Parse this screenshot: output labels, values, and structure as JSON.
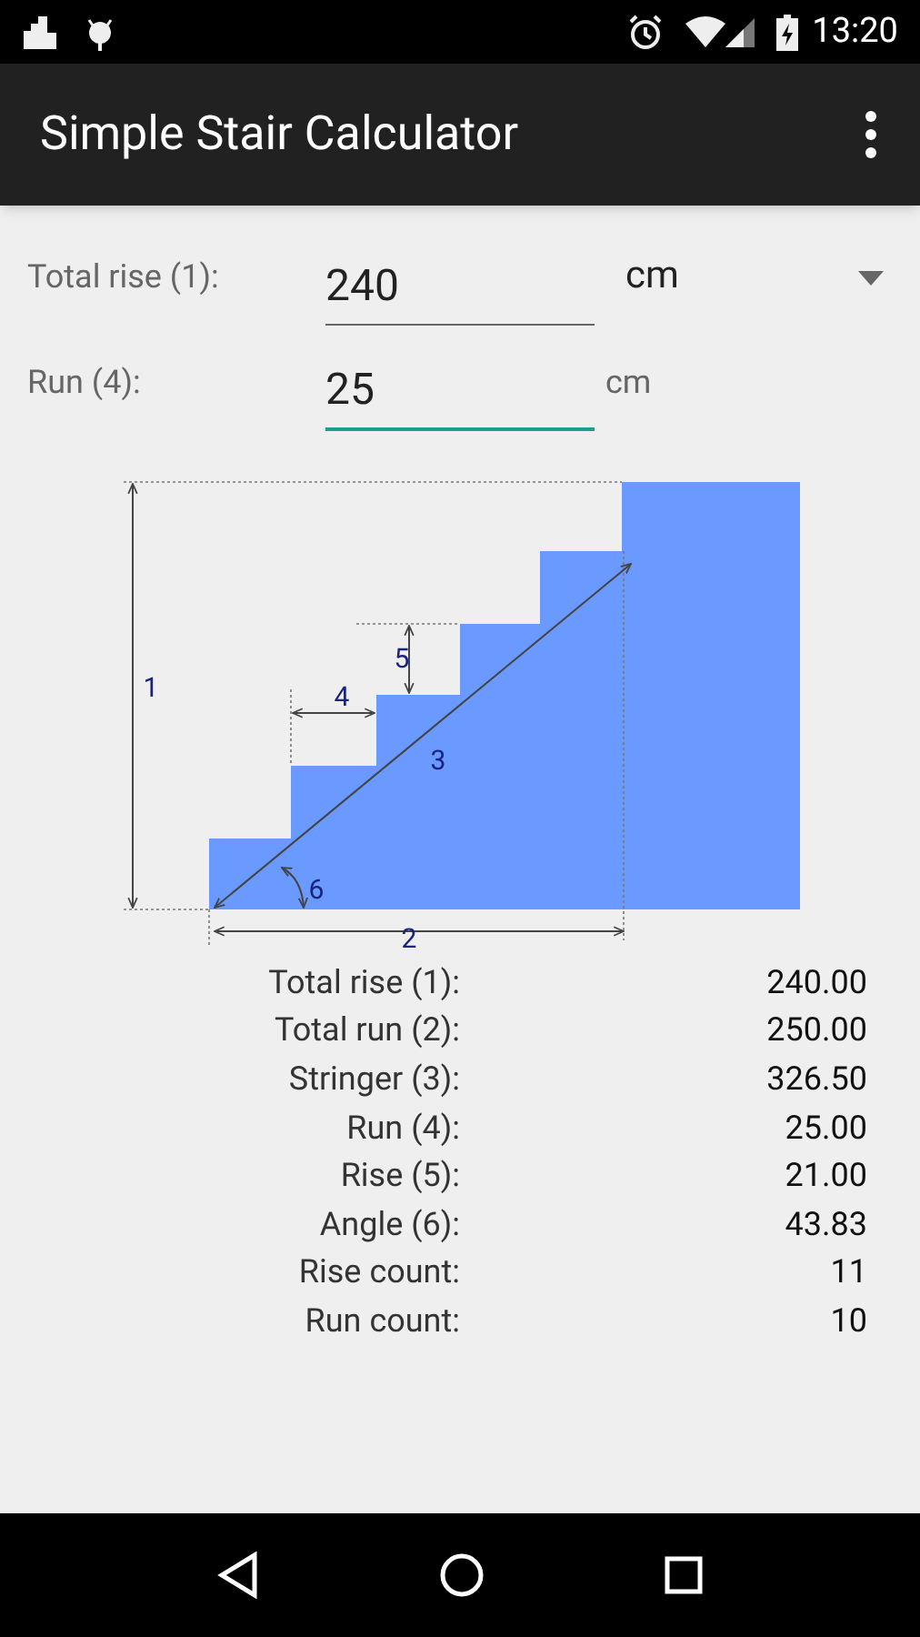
{
  "status_bar": {
    "time": "13:20"
  },
  "app_bar": {
    "title": "Simple Stair Calculator"
  },
  "inputs": [
    {
      "label": "Total rise (1):",
      "value": "240",
      "unit": "cm",
      "kind": "dropdown",
      "focused": false
    },
    {
      "label": "Run (4):",
      "value": "25",
      "unit": "cm",
      "kind": "plain",
      "focused": true
    }
  ],
  "diagram": {
    "labels": [
      "1",
      "2",
      "3",
      "4",
      "5",
      "6"
    ]
  },
  "results": [
    {
      "label": "Total rise (1):",
      "value": "240.00"
    },
    {
      "label": "Total run (2):",
      "value": "250.00"
    },
    {
      "label": "Stringer (3):",
      "value": "326.50"
    },
    {
      "label": "Run (4):",
      "value": "25.00"
    },
    {
      "label": "Rise (5):",
      "value": "21.00"
    },
    {
      "label": "Angle (6):",
      "value": "43.83"
    },
    {
      "label": "Rise count:",
      "value": "11"
    },
    {
      "label": "Run count:",
      "value": "10"
    }
  ]
}
